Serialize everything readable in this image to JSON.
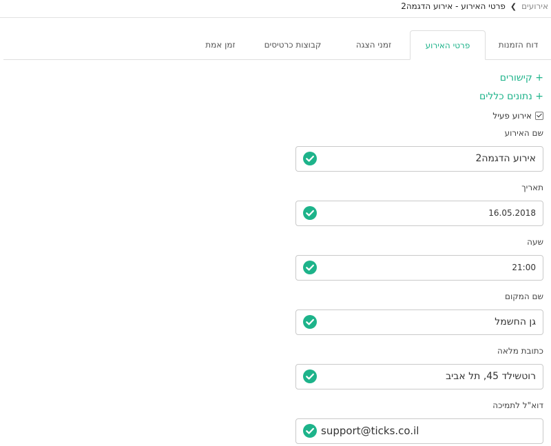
{
  "breadcrumb": {
    "root": "אירועים",
    "separator": "❯",
    "section": "פרטי האירוע",
    "current": "אירוע הדגמה2",
    "dash": " - "
  },
  "tabs": [
    {
      "label": "דוח הזמנות",
      "active": false
    },
    {
      "label": "פרטי האירוע",
      "active": true
    },
    {
      "label": "זמני הצגה",
      "active": false
    },
    {
      "label": "קבוצות כרטיסים",
      "active": false
    },
    {
      "label": "זמן אמת",
      "active": false
    }
  ],
  "sections": {
    "links": "+ קישורים",
    "general": "+ נתונים כללים"
  },
  "active_event": {
    "label": "אירוע פעיל",
    "checked": true
  },
  "fields": {
    "event_name": {
      "label": "שם האירוע",
      "value": "אירוע הדגמה2"
    },
    "date": {
      "label": "תאריך",
      "value": "16.05.2018"
    },
    "time": {
      "label": "שעה",
      "value": "21:00"
    },
    "venue": {
      "label": "שם המקום",
      "value": "גן החשמל"
    },
    "address": {
      "label": "כתובת מלאה",
      "value": "רוטשילד 45, תל אביב"
    },
    "support_email": {
      "label": "דוא\"ל לתמיכה",
      "value": "support@ticks.co.il"
    }
  },
  "icons": {
    "valid": "check-circle-icon",
    "checkbox": "checkbox-icon"
  },
  "colors": {
    "accent": "#1db38a",
    "border": "#c9c9c9",
    "muted_text": "#8a8a8a"
  }
}
